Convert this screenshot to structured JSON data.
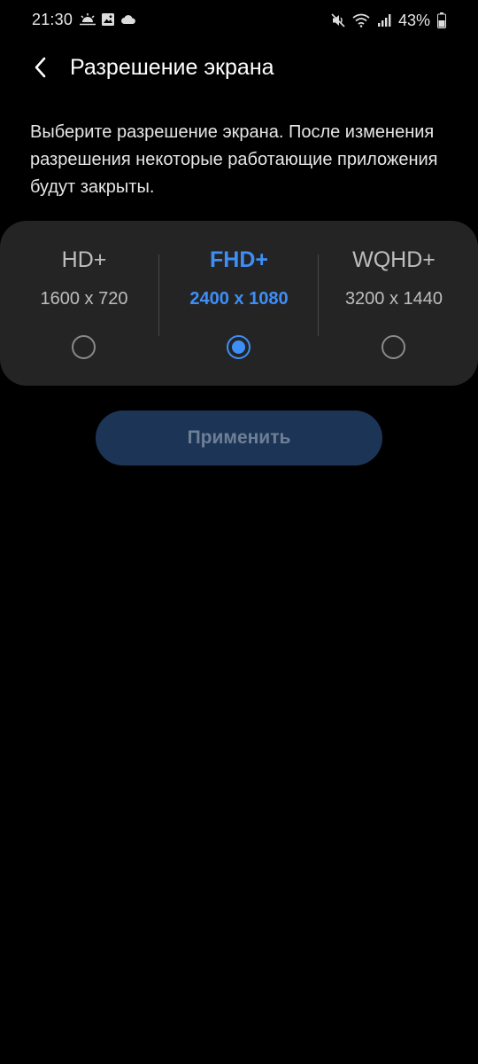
{
  "status_bar": {
    "time": "21:30",
    "battery": "43%",
    "left_icons": [
      "weather-sun-icon",
      "image-icon",
      "cloud-icon"
    ],
    "right_icons": [
      "mute-icon",
      "wifi-icon",
      "signal-icon",
      "battery-icon"
    ]
  },
  "header": {
    "title": "Разрешение экрана",
    "back_icon": "chevron-left-icon"
  },
  "description": "Выберите разрешение экрана. После изменения разрешения некоторые работающие приложения будут закрыты.",
  "options": [
    {
      "name": "HD+",
      "resolution": "1600 x 720",
      "selected": false
    },
    {
      "name": "FHD+",
      "resolution": "2400 x 1080",
      "selected": true
    },
    {
      "name": "WQHD+",
      "resolution": "3200 x 1440",
      "selected": false
    }
  ],
  "apply_button": {
    "label": "Применить",
    "enabled": false
  },
  "colors": {
    "background": "#000000",
    "card": "#242424",
    "accent": "#3e8ef7",
    "button_disabled_bg": "#1c3557",
    "button_disabled_text": "#6e7f95"
  }
}
